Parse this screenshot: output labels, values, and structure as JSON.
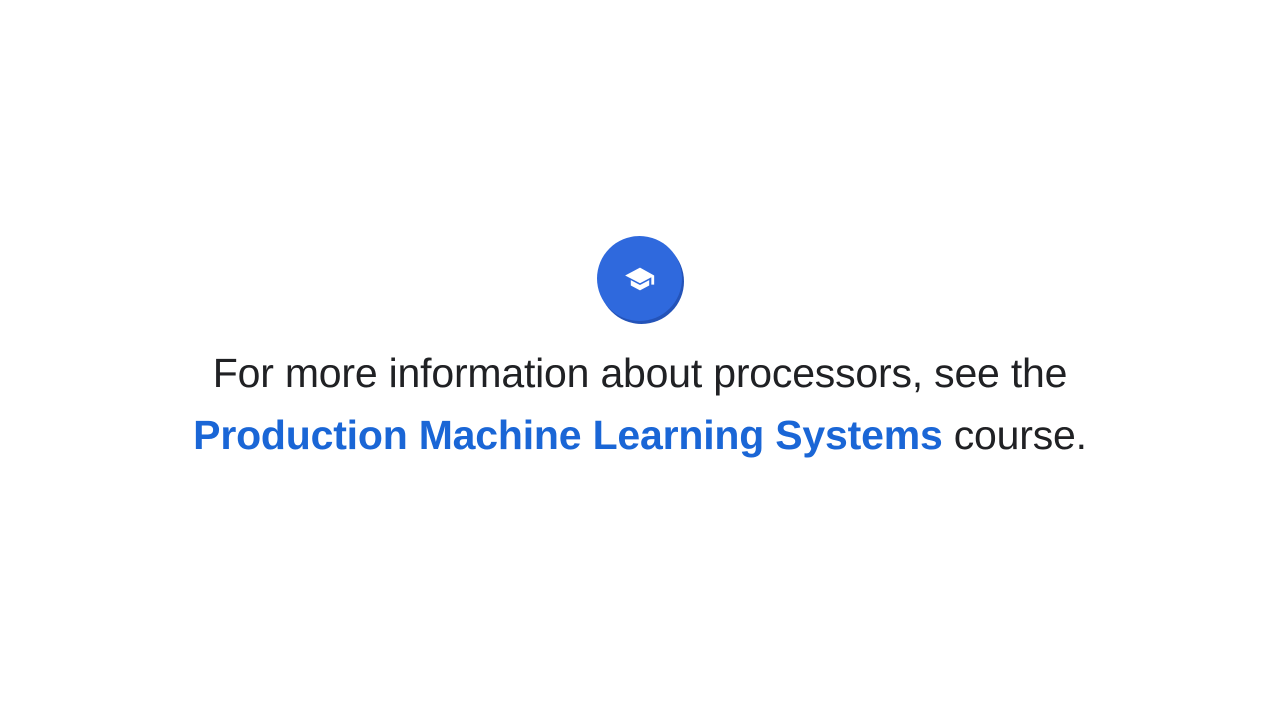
{
  "icon": {
    "name": "graduation-cap-icon",
    "background_color": "#2f69dd",
    "glyph_color": "#ffffff"
  },
  "message": {
    "line1": "For more information about processors, see the",
    "link_text": "Production Machine Learning Systems",
    "line2_suffix": " course.",
    "text_color": "#202124",
    "link_color": "#1a66d6"
  }
}
